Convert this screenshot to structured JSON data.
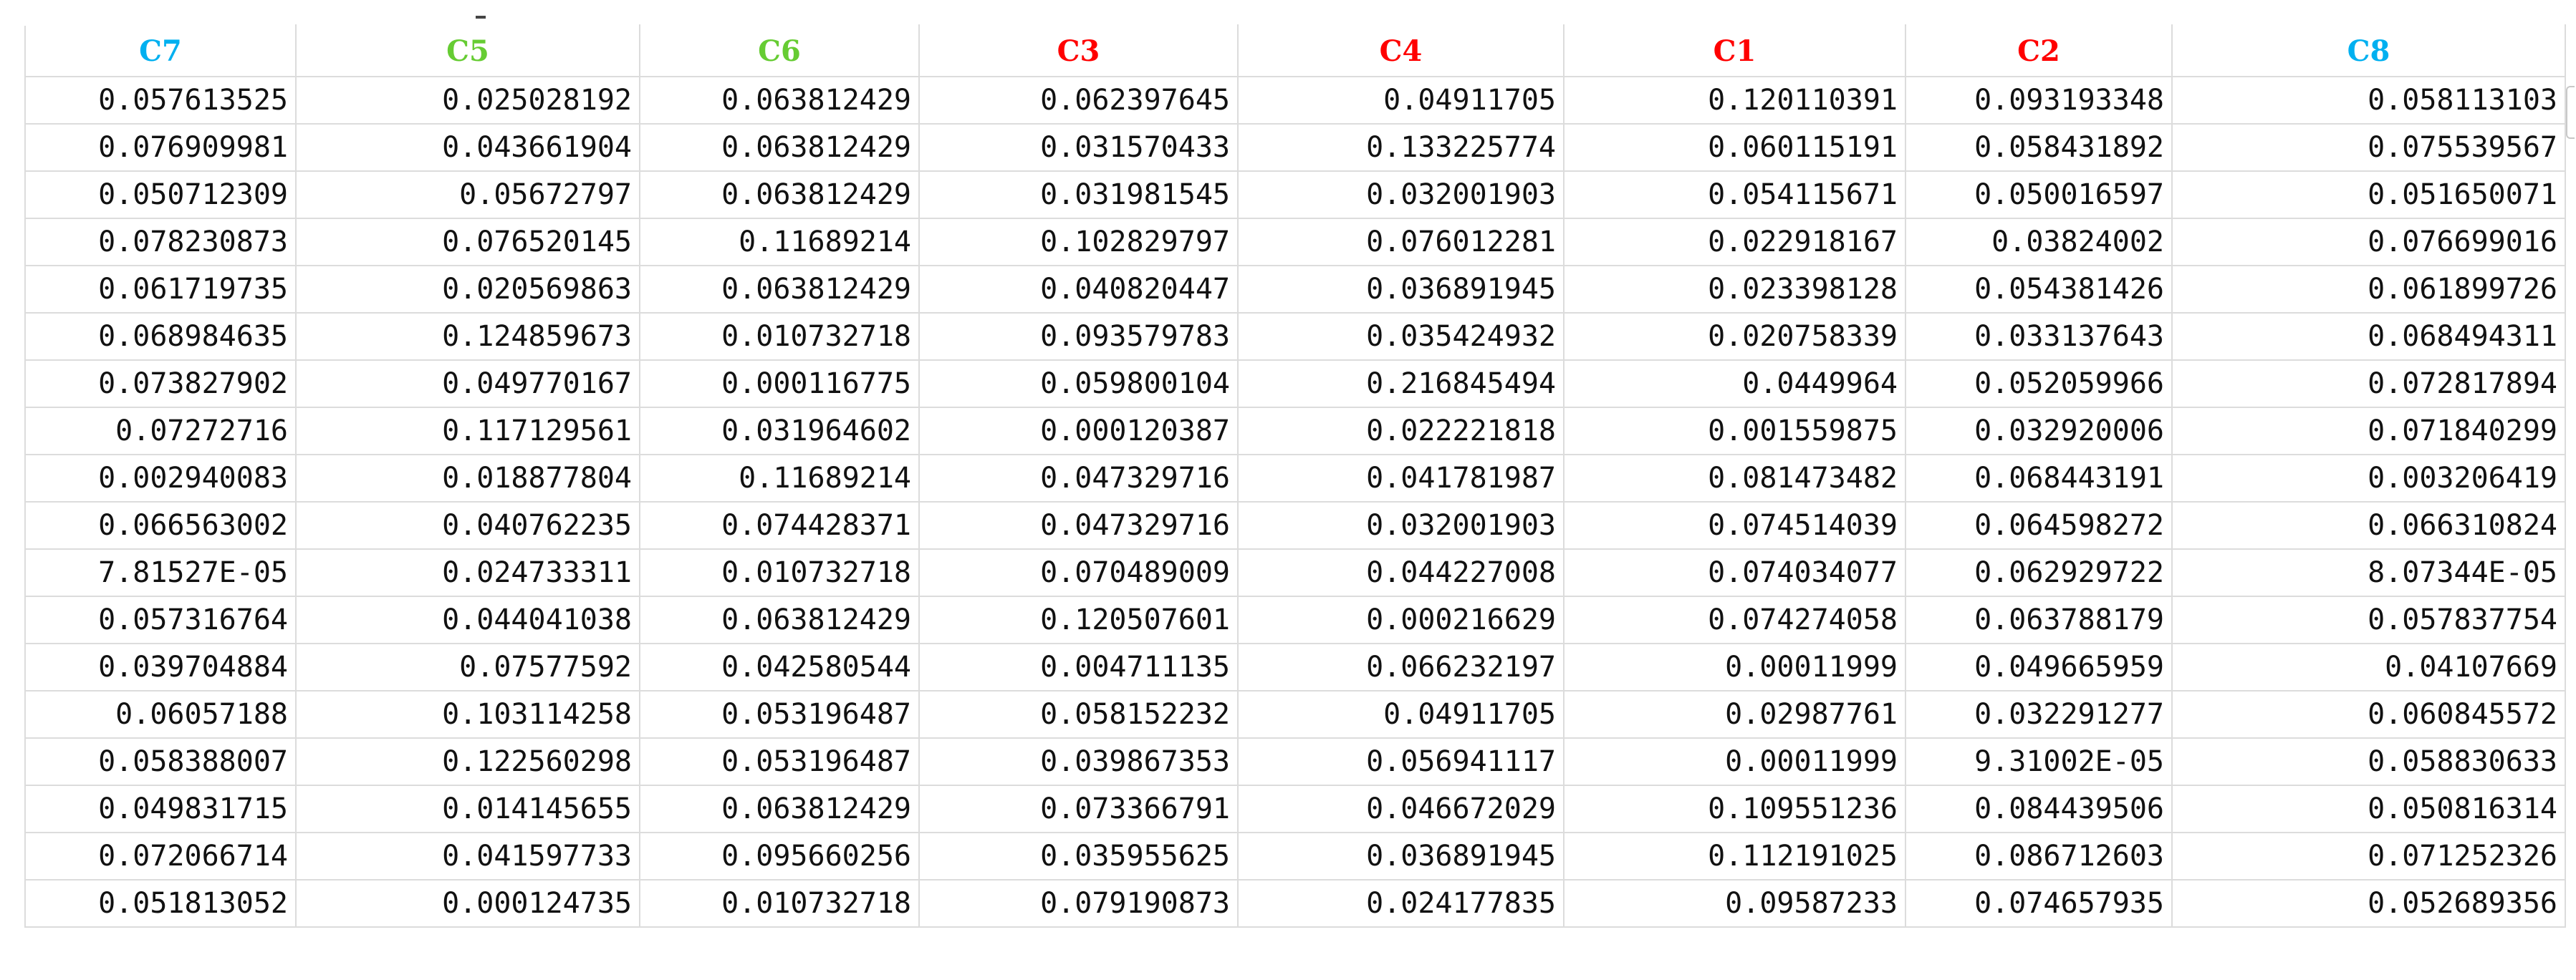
{
  "table": {
    "headers": [
      {
        "label": "C7",
        "color": "#00b0f0"
      },
      {
        "label": "C5",
        "color": "#66cc33"
      },
      {
        "label": "C6",
        "color": "#66cc33"
      },
      {
        "label": "C3",
        "color": "#ff0000"
      },
      {
        "label": "C4",
        "color": "#ff0000"
      },
      {
        "label": "C1",
        "color": "#ff0000"
      },
      {
        "label": "C2",
        "color": "#ff0000"
      },
      {
        "label": "C8",
        "color": "#00b0f0"
      }
    ],
    "rows": [
      [
        "0.057613525",
        "0.025028192",
        "0.063812429",
        "0.062397645",
        "0.04911705",
        "0.120110391",
        "0.093193348",
        "0.058113103"
      ],
      [
        "0.076909981",
        "0.043661904",
        "0.063812429",
        "0.031570433",
        "0.133225774",
        "0.060115191",
        "0.058431892",
        "0.075539567"
      ],
      [
        "0.050712309",
        "0.05672797",
        "0.063812429",
        "0.031981545",
        "0.032001903",
        "0.054115671",
        "0.050016597",
        "0.051650071"
      ],
      [
        "0.078230873",
        "0.076520145",
        "0.11689214",
        "0.102829797",
        "0.076012281",
        "0.022918167",
        "0.03824002",
        "0.076699016"
      ],
      [
        "0.061719735",
        "0.020569863",
        "0.063812429",
        "0.040820447",
        "0.036891945",
        "0.023398128",
        "0.054381426",
        "0.061899726"
      ],
      [
        "0.068984635",
        "0.124859673",
        "0.010732718",
        "0.093579783",
        "0.035424932",
        "0.020758339",
        "0.033137643",
        "0.068494311"
      ],
      [
        "0.073827902",
        "0.049770167",
        "0.000116775",
        "0.059800104",
        "0.216845494",
        "0.0449964",
        "0.052059966",
        "0.072817894"
      ],
      [
        "0.07272716",
        "0.117129561",
        "0.031964602",
        "0.000120387",
        "0.022221818",
        "0.001559875",
        "0.032920006",
        "0.071840299"
      ],
      [
        "0.002940083",
        "0.018877804",
        "0.11689214",
        "0.047329716",
        "0.041781987",
        "0.081473482",
        "0.068443191",
        "0.003206419"
      ],
      [
        "0.066563002",
        "0.040762235",
        "0.074428371",
        "0.047329716",
        "0.032001903",
        "0.074514039",
        "0.064598272",
        "0.066310824"
      ],
      [
        "7.81527E-05",
        "0.024733311",
        "0.010732718",
        "0.070489009",
        "0.044227008",
        "0.074034077",
        "0.062929722",
        "8.07344E-05"
      ],
      [
        "0.057316764",
        "0.044041038",
        "0.063812429",
        "0.120507601",
        "0.000216629",
        "0.074274058",
        "0.063788179",
        "0.057837754"
      ],
      [
        "0.039704884",
        "0.07577592",
        "0.042580544",
        "0.004711135",
        "0.066232197",
        "0.00011999",
        "0.049665959",
        "0.04107669"
      ],
      [
        "0.06057188",
        "0.103114258",
        "0.053196487",
        "0.058152232",
        "0.04911705",
        "0.02987761",
        "0.032291277",
        "0.060845572"
      ],
      [
        "0.058388007",
        "0.122560298",
        "0.053196487",
        "0.039867353",
        "0.056941117",
        "0.00011999",
        "9.31002E-05",
        "0.058830633"
      ],
      [
        "0.049831715",
        "0.014145655",
        "0.063812429",
        "0.073366791",
        "0.046672029",
        "0.109551236",
        "0.084439506",
        "0.050816314"
      ],
      [
        "0.072066714",
        "0.041597733",
        "0.095660256",
        "0.035955625",
        "0.036891945",
        "0.112191025",
        "0.086712603",
        "0.071252326"
      ],
      [
        "0.051813052",
        "0.000124735",
        "0.010732718",
        "0.079190873",
        "0.024177835",
        "0.09587233",
        "0.074657935",
        "0.052689356"
      ]
    ]
  }
}
